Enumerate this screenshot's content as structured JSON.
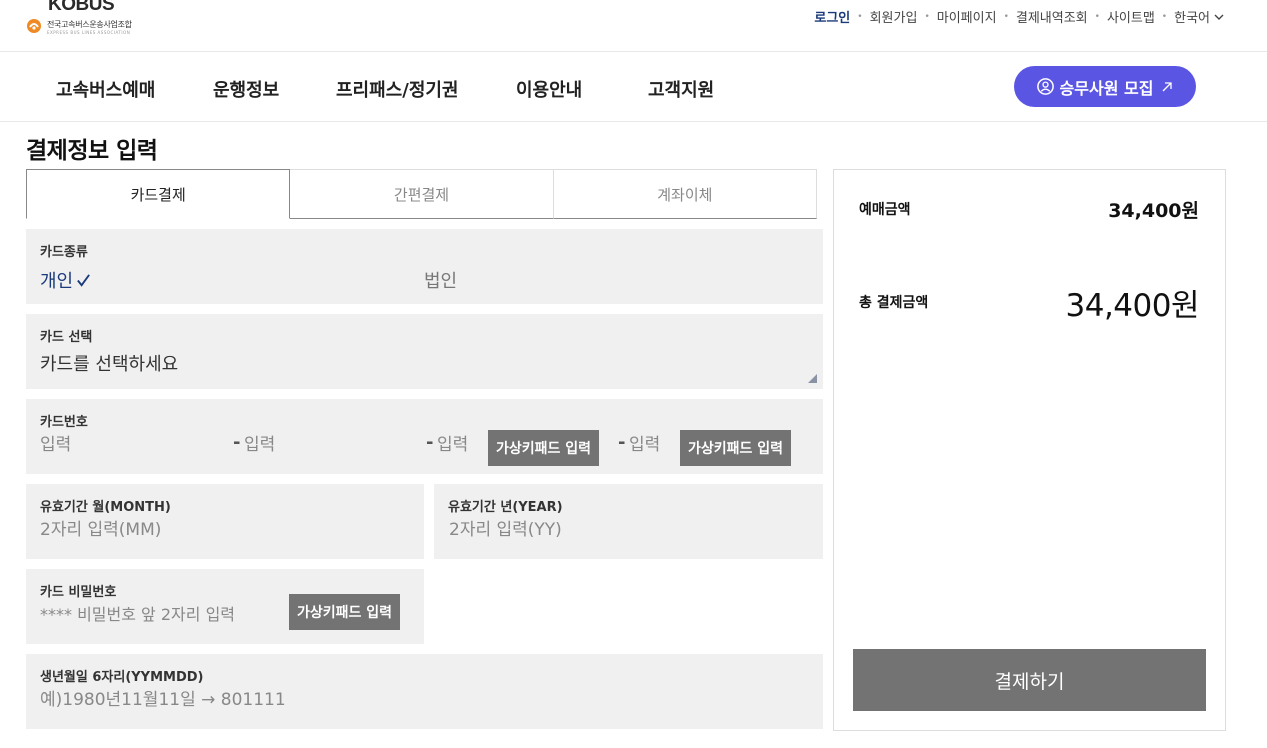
{
  "logo": {
    "word": "KOBUS",
    "org_name": "전국고속버스운송사업조합",
    "org_sub": "EXPRESS BUS LINES ASSOCIATION"
  },
  "utility_nav": {
    "items": [
      "로그인",
      "회원가입",
      "마이페이지",
      "결제내역조회",
      "사이트맵"
    ],
    "language": "한국어"
  },
  "main_nav": {
    "items": [
      "고속버스예매",
      "운행정보",
      "프리패스/정기권",
      "이용안내",
      "고객지원"
    ],
    "recruit_button": "승무사원 모집"
  },
  "page": {
    "title": "결제정보 입력"
  },
  "tabs": [
    {
      "label": "카드결제",
      "active": true
    },
    {
      "label": "간편결제",
      "active": false
    },
    {
      "label": "계좌이체",
      "active": false
    }
  ],
  "form": {
    "card_type": {
      "label": "카드종류",
      "options": [
        "개인",
        "법인"
      ],
      "selected": "개인"
    },
    "card_select": {
      "label": "카드 선택",
      "value": "카드를 선택하세요"
    },
    "card_number": {
      "label": "카드번호",
      "placeholder": "입력",
      "separator": "-",
      "virtual_keypad": "가상키패드 입력"
    },
    "expiry_month": {
      "label": "유효기간 월(MONTH)",
      "placeholder": "2자리 입력(MM)"
    },
    "expiry_year": {
      "label": "유효기간 년(YEAR)",
      "placeholder": "2자리 입력(YY)"
    },
    "card_password": {
      "label": "카드 비밀번호",
      "placeholder": "**** 비밀번호 앞 2자리 입력",
      "virtual_keypad": "가상키패드 입력"
    },
    "birth_date": {
      "label": "생년월일 6자리(YYMMDD)",
      "placeholder": "예)1980년11월11일 → 801111"
    }
  },
  "summary": {
    "ticket_amount_label": "예매금액",
    "ticket_amount": "34,400원",
    "total_label": "총 결제금액",
    "total_amount": "34,400원",
    "pay_button": "결제하기"
  },
  "colors": {
    "accent_purple": "#5b55e4",
    "selected_navy": "#1a3a7a",
    "field_bg": "#f0f0f0",
    "button_gray": "#737373"
  }
}
